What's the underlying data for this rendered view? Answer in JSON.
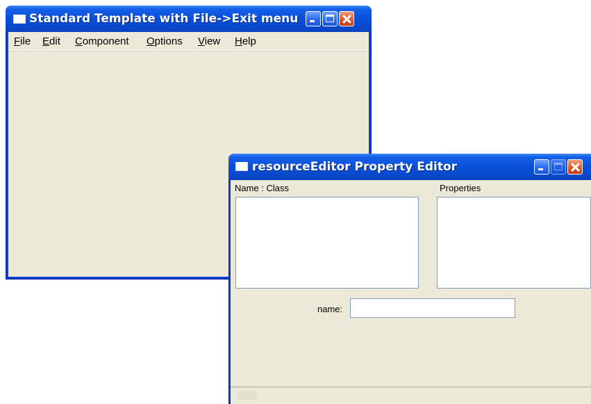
{
  "window1": {
    "title": "Standard Template with File->Exit menu",
    "icon": "application-window-icon",
    "menu": [
      {
        "mnemonic": "F",
        "rest": "ile"
      },
      {
        "mnemonic": "E",
        "rest": "dit"
      },
      {
        "mnemonic": "C",
        "rest": "omponent"
      },
      {
        "mnemonic": "O",
        "rest": "ptions"
      },
      {
        "mnemonic": "V",
        "rest": "iew"
      },
      {
        "mnemonic": "H",
        "rest": "elp"
      }
    ]
  },
  "window2": {
    "title": "resourceEditor Property Editor",
    "icon": "application-window-icon",
    "name_class_label": "Name  :  Class",
    "properties_label": "Properties",
    "name_field_label": "name:",
    "name_field_value": ""
  },
  "colors": {
    "titlebar_blue": "#0a4fd9",
    "window_face": "#ece9d8",
    "close_button": "#e05a2a"
  }
}
